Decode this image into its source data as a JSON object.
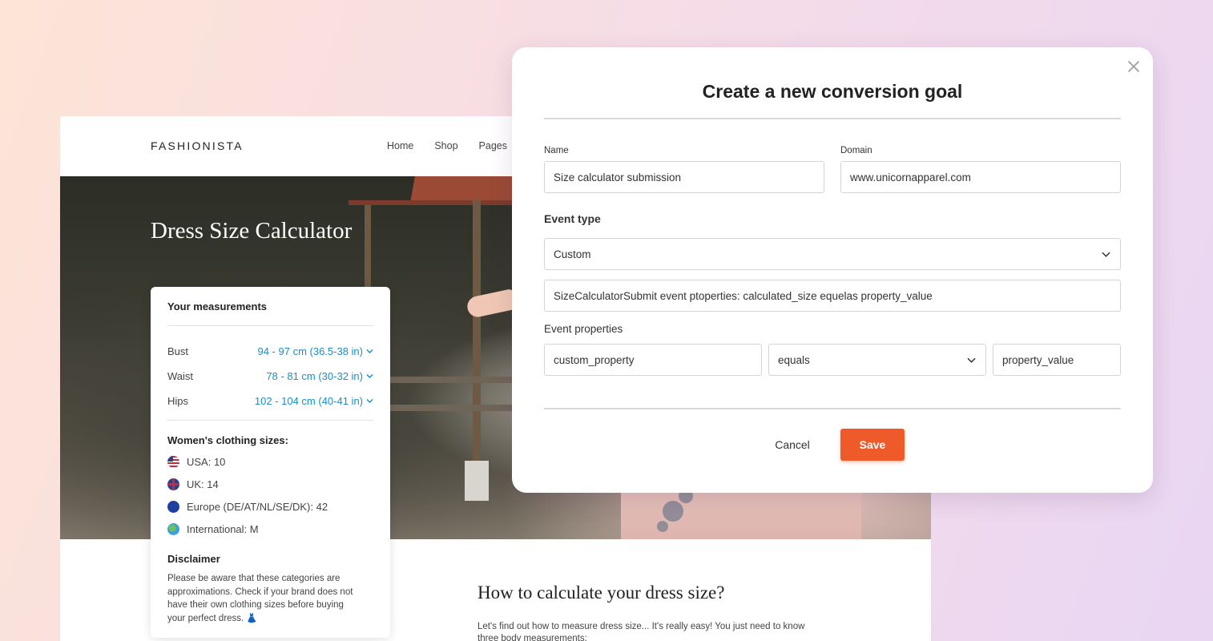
{
  "site": {
    "brand": "FASHIONISTA",
    "nav": [
      "Home",
      "Shop",
      "Pages"
    ],
    "hero_title": "Dress Size Calculator",
    "article_title": "How to calculate your dress size?",
    "article_text": "Let's find out how to measure dress size... It's really easy! You just need to know three body measurements:"
  },
  "card": {
    "title": "Your measurements",
    "measurements": [
      {
        "label": "Bust",
        "value": "94 - 97 cm (36.5-38 in)"
      },
      {
        "label": "Waist",
        "value": "78 - 81 cm (30-32 in)"
      },
      {
        "label": "Hips",
        "value": "102 - 104 cm (40-41 in)"
      }
    ],
    "sizes_title": "Women's clothing sizes:",
    "sizes": [
      {
        "flag": "us-flag-icon",
        "text": "USA: 10"
      },
      {
        "flag": "uk-flag-icon",
        "text": "UK: 14"
      },
      {
        "flag": "eu-flag-icon",
        "text": "Europe (DE/AT/NL/SE/DK): 42"
      },
      {
        "flag": "globe-icon",
        "text": "International: M"
      }
    ],
    "disclaimer_title": "Disclaimer",
    "disclaimer_text": "Please be aware that these categories are approximations. Check if your brand does not have their own clothing sizes before buying your perfect dress. 👗"
  },
  "modal": {
    "title": "Create a new conversion goal",
    "name_label": "Name",
    "name_value": "Size calculator submission",
    "domain_label": "Domain",
    "domain_value": "www.unicornapparel.com",
    "event_type_label": "Event type",
    "event_type_value": "Custom",
    "event_description": "SizeCalculatorSubmit event ptoperties: calculated_size equelas property_value",
    "event_properties_label": "Event properties",
    "property_key": "custom_property",
    "operator": "equals",
    "property_value": "property_value",
    "cancel_label": "Cancel",
    "save_label": "Save"
  },
  "colors": {
    "accent": "#ee5a2a",
    "link": "#1a8fc4"
  }
}
